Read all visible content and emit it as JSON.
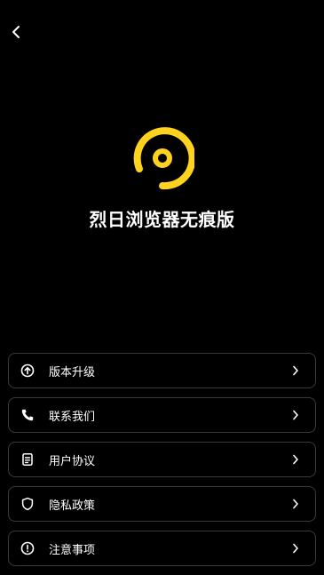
{
  "header": {
    "back_icon": "chevron-left-icon"
  },
  "app": {
    "logo_icon": "app-logo-icon",
    "logo_color": "#FFD21F",
    "name": "烈日浏览器无痕版"
  },
  "menu": {
    "items": [
      {
        "label": "版本升级",
        "icon": "arrow-up-circle-icon"
      },
      {
        "label": "联系我们",
        "icon": "phone-icon"
      },
      {
        "label": "用户协议",
        "icon": "document-icon"
      },
      {
        "label": "隐私政策",
        "icon": "shield-icon"
      },
      {
        "label": "注意事项",
        "icon": "info-circle-icon"
      }
    ]
  }
}
